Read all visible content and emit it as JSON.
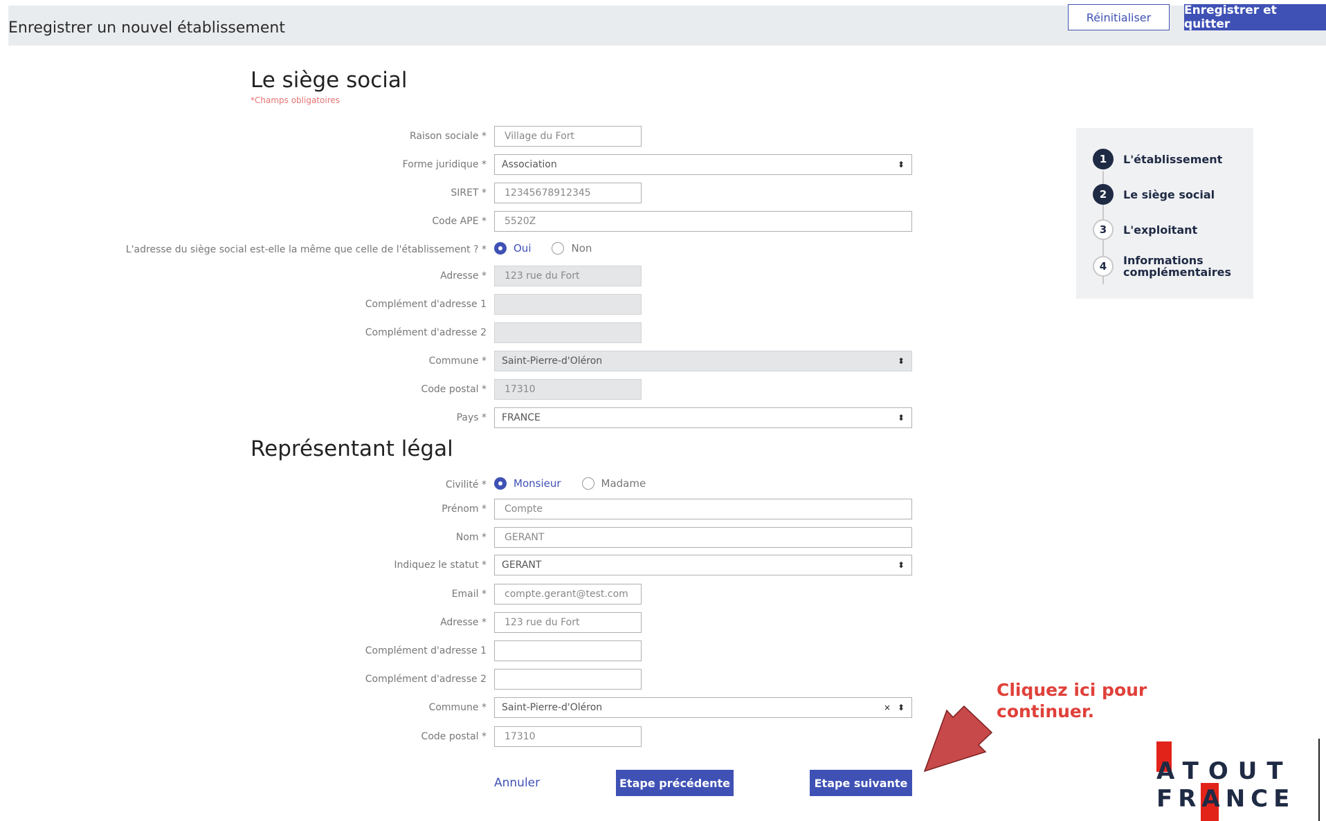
{
  "header": {
    "title": "Enregistrer un nouvel établissement",
    "reset_label": "Réinitialiser",
    "save_quit_label": "Enregistrer et quitter"
  },
  "siege": {
    "title": "Le siège social",
    "required_note": "*Champs obligatoires",
    "fields": {
      "raison_sociale": {
        "label": "Raison sociale *",
        "placeholder": "Village du Fort"
      },
      "forme_juridique": {
        "label": "Forme juridique *",
        "value": "Association"
      },
      "siret": {
        "label": "SIRET *",
        "placeholder": "12345678912345"
      },
      "code_ape": {
        "label": "Code APE *",
        "placeholder": "5520Z"
      },
      "same_address": {
        "label": "L'adresse du siège social est-elle la même que celle de l'établissement ? *",
        "yes": "Oui",
        "no": "Non",
        "selected": "Oui"
      },
      "adresse": {
        "label": "Adresse *",
        "value": "123 rue du Fort"
      },
      "complement1": {
        "label": "Complément d'adresse 1",
        "value": ""
      },
      "complement2": {
        "label": "Complément d'adresse 2",
        "value": ""
      },
      "commune": {
        "label": "Commune *",
        "value": "Saint-Pierre-d'Oléron"
      },
      "code_postal": {
        "label": "Code postal *",
        "value": "17310"
      },
      "pays": {
        "label": "Pays *",
        "value": "FRANCE"
      }
    }
  },
  "representant": {
    "title": "Représentant légal",
    "fields": {
      "civilite": {
        "label": "Civilité *",
        "option1": "Monsieur",
        "option2": "Madame",
        "selected": "Monsieur"
      },
      "prenom": {
        "label": "Prénom *",
        "placeholder": "Compte"
      },
      "nom": {
        "label": "Nom *",
        "placeholder": "GERANT"
      },
      "statut": {
        "label": "Indiquez le statut *",
        "value": "GERANT"
      },
      "email": {
        "label": "Email *",
        "placeholder": "compte.gerant@test.com"
      },
      "adresse": {
        "label": "Adresse *",
        "placeholder": "123 rue du Fort"
      },
      "complement1": {
        "label": "Complément d'adresse 1",
        "value": ""
      },
      "complement2": {
        "label": "Complément d'adresse 2",
        "value": ""
      },
      "commune": {
        "label": "Commune *",
        "value": "Saint-Pierre-d'Oléron"
      },
      "code_postal": {
        "label": "Code postal *",
        "placeholder": "17310"
      }
    }
  },
  "footer": {
    "cancel_label": "Annuler",
    "prev_label": "Etape précédente",
    "next_label": "Etape suivante"
  },
  "stepper": {
    "steps": [
      {
        "num": "1",
        "label": "L'établissement",
        "state": "done"
      },
      {
        "num": "2",
        "label": "Le siège social",
        "state": "current"
      },
      {
        "num": "3",
        "label": "L'exploitant",
        "state": "todo"
      },
      {
        "num": "4",
        "label": "Informations complémentaires",
        "state": "todo"
      }
    ]
  },
  "annotation": {
    "callout_line1": "Cliquez ici pour",
    "callout_line2": "continuer.",
    "color": "#e0403a",
    "arrow_color": "#c8494a"
  },
  "logo": {
    "line1": "ATOUT",
    "line2": "FRANCE",
    "accent_color": "#e2231a"
  },
  "colors": {
    "primary": "#3f51b5",
    "header_bg": "#e9ecef",
    "disabled_field": "#e4e6e8"
  }
}
